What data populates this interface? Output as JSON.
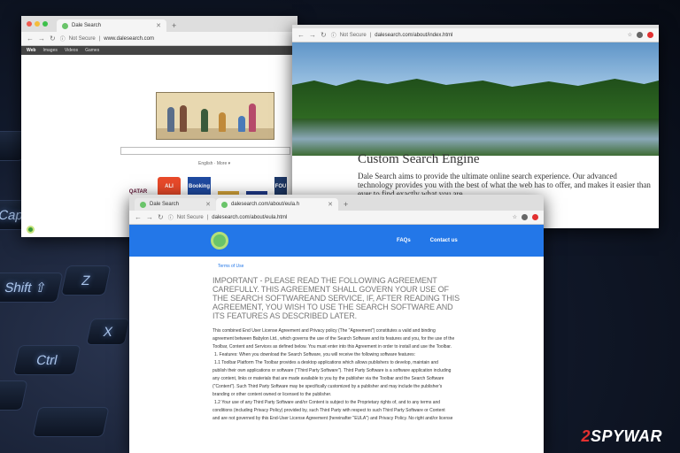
{
  "keyboard": {
    "keys": [
      "Shift",
      "Z",
      "Ctrl",
      "Caps",
      "X"
    ]
  },
  "window1": {
    "tab_title": "Dale Search",
    "security": "Not Secure",
    "url": "www.dalesearch.com",
    "menu": [
      "Web",
      "Images",
      "Videos",
      "Games"
    ],
    "language_line": "English · More ▾",
    "partner_logos": [
      "QATAR",
      "ALI",
      "Booking",
      "",
      "",
      "FOU"
    ]
  },
  "window2": {
    "security": "Not Secure",
    "url": "dalesearch.com/about/index.html",
    "heading": "Custom Search Engine",
    "paragraph": "Dale Search aims to provide the ultimate online search experience. Our advanced technology provides you with the best of what the web has to offer, and makes it easier than ever to find exactly what you are"
  },
  "window3": {
    "tab1_title": "Dale Search",
    "tab2_title": "dalesearch.com/about/eula.h",
    "security": "Not Secure",
    "url": "dalesearch.com/about/eula.html",
    "nav": [
      "FAQs",
      "Contact us"
    ],
    "terms_link": "Terms of Use",
    "important_heading": "IMPORTANT - PLEASE READ THE FOLLOWING AGREEMENT CAREFULLY. THIS AGREEMENT SHALL GOVERN YOUR USE OF THE SEARCH SOFTWAREAND SERVICE, IF, AFTER READING THIS AGREEMENT, YOU WISH TO USE THE SEARCH SOFTWARE AND ITS FEATURES AS DESCRIBED LATER.",
    "body_lines": [
      "This combined End User License Agreement and Privacy policy (The \"Agreement\") constitutes a valid and binding",
      "agreement between Babylon Ltd., which governs the use of the Search Software and its features and you, for the use of the",
      "Toolbar, Content and Services as defined below. You must enter into this Agreement in order to install and use the Toolbar.",
      "1. Features: When you download the Search Software, you will receive the following software features:",
      "1.1 Toolbar Platform The Toolbar provides a desktop applications which allows publishers to develop, maintain and",
      "publish their own applications or software (\"Third Party Software\"). Third Party Software is a software application including",
      "any content, links or materials that are made available to you by the publisher via the Toolbar and the Search Software",
      "(\"Content\"). Such Third Party Software may be specifically customized by a publisher and may include the publisher's",
      "branding or other content owned or licensed to the publisher.",
      "1.2 Your use of any Third Party Software and/or Content is subject to the Proprietary rights of, and to any terms and",
      "conditions (including Privacy Policy) provided by, such Third Party with respect to such Third Party Software or Content",
      "and are not governed by this End-User License Agreement (hereinafter \"EULA\") and Privacy Policy. No right and/or license"
    ]
  },
  "watermark": {
    "prefix": "2",
    "text": "SPYWAR"
  },
  "colors": {
    "accent_blue": "#2377e8",
    "close_red": "#e23030"
  }
}
